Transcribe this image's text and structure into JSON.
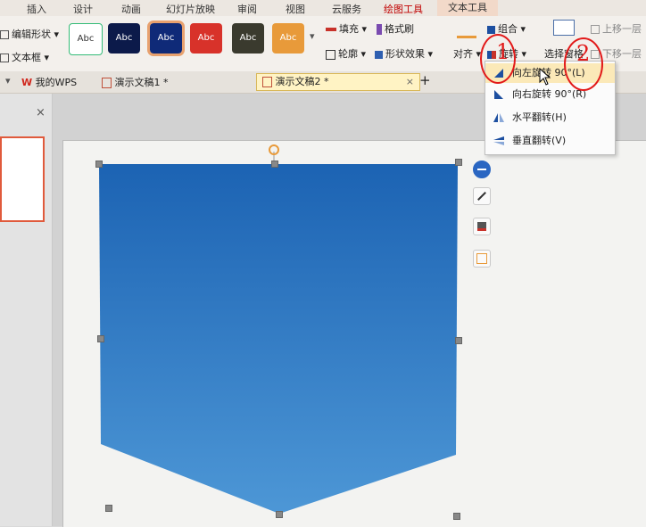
{
  "ribbon_tabs": [
    "插入",
    "设计",
    "动画",
    "幻灯片放映",
    "审阅",
    "视图",
    "云服务",
    "绘图工具",
    "文本工具"
  ],
  "left_tools": {
    "edit_shape": "编辑形状",
    "text_box": "文本框"
  },
  "shape_styles": [
    "Abc",
    "Abc",
    "Abc",
    "Abc",
    "Abc",
    "Abc"
  ],
  "format_group": {
    "fill": "填充",
    "format_painter": "格式刷",
    "outline": "轮廓",
    "shape_effect": "形状效果"
  },
  "arrange_group": {
    "group": "组合",
    "align": "对齐",
    "rotate": "旋转",
    "selection_pane": "选择窗格",
    "bring_forward": "上移一层",
    "send_backward": "下移一层"
  },
  "doc_tabs": {
    "my_wps": "我的WPS",
    "doc1": "演示文稿1 *",
    "doc2": "演示文稿2 *",
    "add": "+"
  },
  "rotate_menu": [
    {
      "label": "向左旋转 90°(L)",
      "icon": "rotate-left-icon"
    },
    {
      "label": "向右旋转 90°(R)",
      "icon": "rotate-right-icon"
    },
    {
      "label": "水平翻转(H)",
      "icon": "flip-horizontal-icon"
    },
    {
      "label": "垂直翻转(V)",
      "icon": "flip-vertical-icon"
    }
  ],
  "annotations": {
    "circle1": "1",
    "circle2": "2"
  },
  "colors": {
    "shape_top": "#1c63b3",
    "shape_bottom": "#4d97d6",
    "active_tab": "#c00000",
    "annotation": "#e21a1a"
  }
}
